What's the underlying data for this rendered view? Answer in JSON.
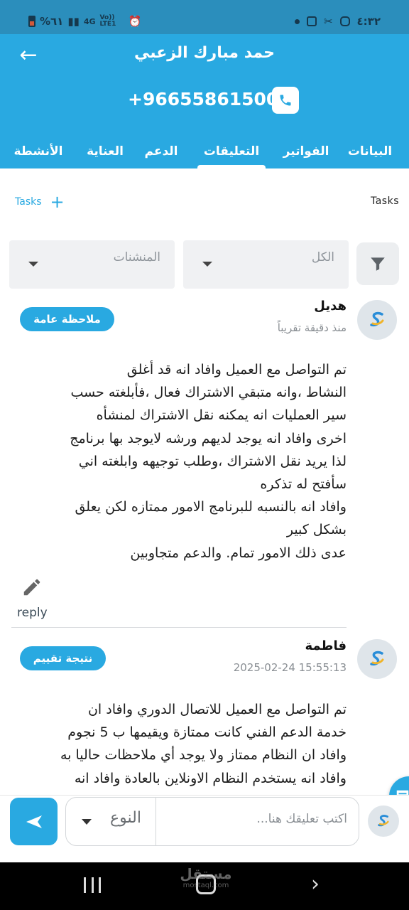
{
  "status_bar": {
    "time": "٤:٣٢",
    "battery": "%٦١",
    "network": "4G",
    "volte": "Vo)) LTE1"
  },
  "header": {
    "title": "حمد مبارك الزعبي",
    "phone": "+96655861500",
    "colors": {
      "primary": "#29a9e1",
      "status_bar": "#2b8ebc"
    }
  },
  "tabs": [
    {
      "label": "البيانات"
    },
    {
      "label": "الفواتير"
    },
    {
      "label": "التعليقات",
      "active": true
    },
    {
      "label": "الدعم"
    },
    {
      "label": "العناية"
    },
    {
      "label": "الأنشطة"
    }
  ],
  "tasks": {
    "title": "Tasks",
    "add_label": "Tasks"
  },
  "filters": {
    "type_value": "الكل",
    "mention_value": "المنشنات"
  },
  "comments": [
    {
      "author": "هديل",
      "time": "منذ دقيقة تقريباً",
      "badge": "ملاحظة عامة",
      "body": "تم التواصل مع العميل وافاد انه قد أغلق\nالنشاط ،وانه متبقي الاشتراك فعال ،فأبلغته حسب\nسير العمليات انه يمكنه نقل الاشتراك لمنشأه\nاخرى وافاد انه يوجد لديهم ورشه  لايوجد بها برنامج\nلذا يريد نقل الاشتراك ،وطلب توجيهه   وابلغته اني\nسأفتح له تذكره\nوافاد انه بالنسبه للبرنامج الامور ممتازه لكن يعلق\nبشكل كبير\nعدى ذلك الامور تمام. والدعم متجاوبين",
      "reply_label": "reply"
    },
    {
      "author": "فاطمة",
      "time": "2025-02-24 15:55:13",
      "badge": "نتيجة تقييم",
      "body": "تم التواصل مع العميل للاتصال الدوري وافاد ان\nخدمة الدعم الفني كانت ممتازة ويقيمها ب 5 نجوم\nوافاد ان النظام ممتاز ولا يوجد أي ملاحظات حاليا به\nوافاد انه يستخدم النظام الاونلاين بالعادة وافاد انه"
    }
  ],
  "composer": {
    "placeholder": "اكتب تعليقك هنا...",
    "type_label": "النوع"
  },
  "watermark": {
    "text": "مستقل",
    "sub": "mostaql.com"
  }
}
